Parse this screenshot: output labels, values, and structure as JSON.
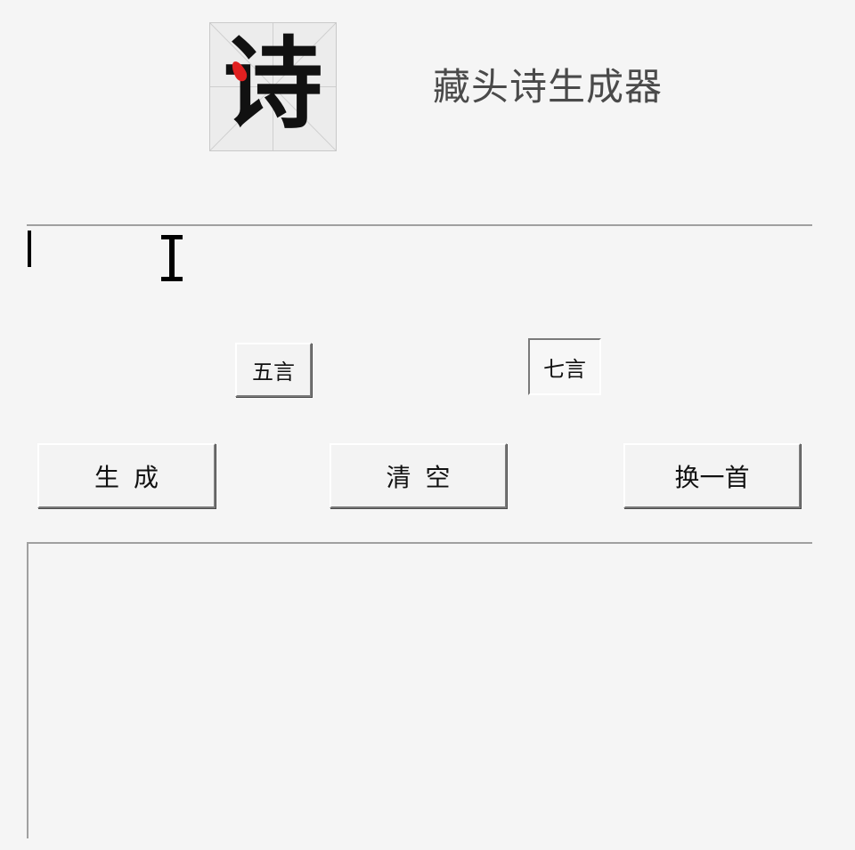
{
  "header": {
    "logo_char": "诗",
    "title": "藏头诗生成器"
  },
  "input": {
    "value": "",
    "placeholder": ""
  },
  "options": {
    "five_label": "五言",
    "seven_label": "七言",
    "selected": "七言"
  },
  "actions": {
    "generate_label": "生成",
    "clear_label": "清空",
    "next_label": "换一首"
  },
  "output": {
    "text": ""
  },
  "icons": {
    "logo": "poem-logo-icon",
    "cursor": "text-cursor-icon"
  },
  "colors": {
    "background": "#f5f5f5",
    "logo_accent": "#e02020",
    "text": "#111111"
  }
}
